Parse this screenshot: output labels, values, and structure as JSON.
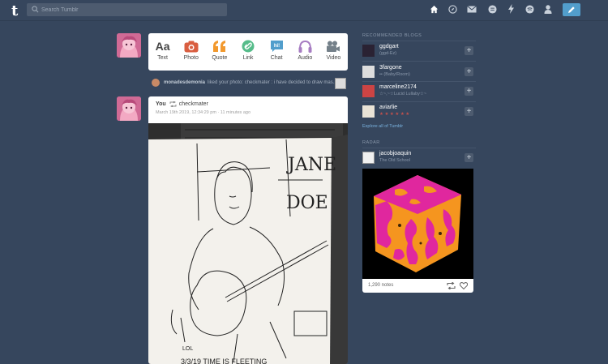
{
  "topbar": {
    "logo": "t",
    "search_placeholder": "Search Tumblr",
    "nav_icons": [
      "home-icon",
      "explore-icon",
      "inbox-icon",
      "messages-icon",
      "activity-icon",
      "patio-icon",
      "account-icon"
    ],
    "compose_icon": "pencil-icon"
  },
  "composer": {
    "types": [
      {
        "label": "Text",
        "glyph": "Aa",
        "color": "#444444"
      },
      {
        "label": "Photo",
        "glyph": "cam",
        "color": "#d95e40"
      },
      {
        "label": "Quote",
        "glyph": "““",
        "color": "#f2992e"
      },
      {
        "label": "Link",
        "glyph": "link",
        "color": "#56bc8a"
      },
      {
        "label": "Chat",
        "glyph": "hi!",
        "color": "#529ecc"
      },
      {
        "label": "Audio",
        "glyph": "aud",
        "color": "#a77dc2"
      },
      {
        "label": "Video",
        "glyph": "vid",
        "color": "#748089"
      }
    ]
  },
  "activity": {
    "user": "monadesdemonia",
    "text": "liked your photo: checkmater : i have decided to draw mas..."
  },
  "post": {
    "author": "You",
    "reblogged_from": "checkmater",
    "date": "March 19th 2019, 12:34:29 pm · 11 minutes ago",
    "drawing_text": {
      "title_line1": "JANE",
      "title_line2": "DOE",
      "signature": "LOL",
      "caption": "3/3/19 TIME IS FLEETING"
    }
  },
  "sidebar": {
    "recommended_title": "RECOMMENDED BLOGS",
    "blogs": [
      {
        "name": "ggdgart",
        "subtitle": "(ggd-Ez)"
      },
      {
        "name": "3fargone",
        "subtitle": "•• (Baby/Room)"
      },
      {
        "name": "marceline2174",
        "subtitle": "☆~,~☆Lucid Lullaby☆~"
      },
      {
        "name": "aviarlie",
        "subtitle": "★ ★ ★ ★ ★ ★"
      }
    ],
    "explore_label": "Explore all of Tumblr",
    "radar_title": "RADAR",
    "radar_blog": {
      "name": "jacobjoaquin",
      "subtitle": "The Old School"
    },
    "radar_notes": "1,290 notes"
  },
  "colors": {
    "background": "#36465d",
    "accent": "#529ecc",
    "cube_magenta": "#e0279e",
    "cube_orange": "#f5951f"
  }
}
